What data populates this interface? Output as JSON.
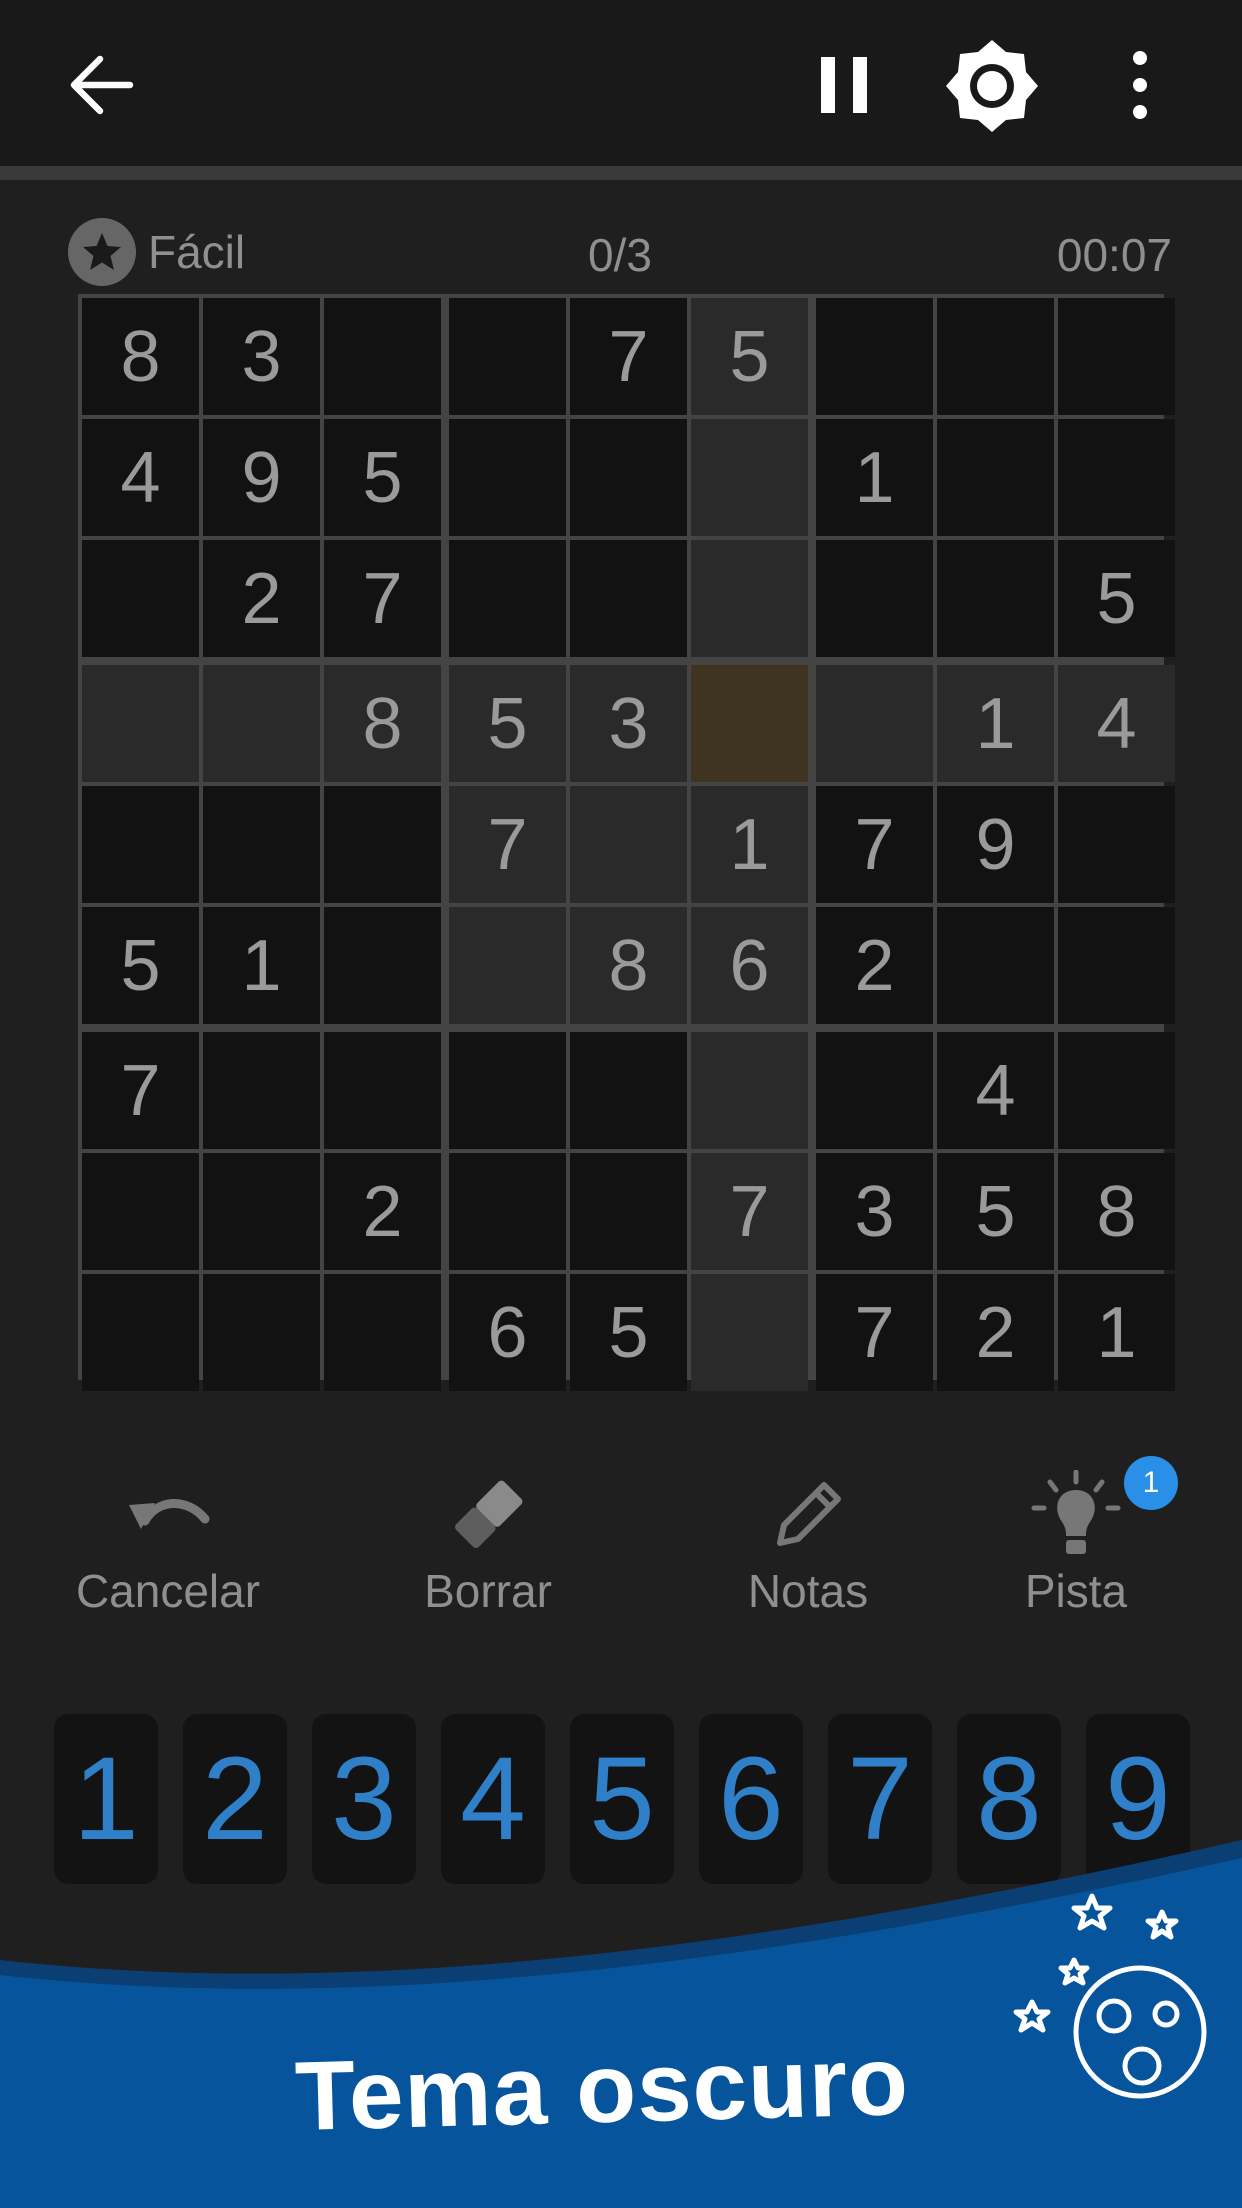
{
  "toolbar": {
    "back_icon": "arrow-left-icon",
    "pause_icon": "pause-icon",
    "brightness_icon": "brightness-icon",
    "more_icon": "more-vertical-icon"
  },
  "status": {
    "difficulty": "Fácil",
    "difficulty_icon": "star-icon",
    "mistakes": "0/3",
    "timer": "00:07"
  },
  "board": {
    "grid": [
      [
        "8",
        "3",
        "",
        "",
        "7",
        "5",
        "",
        "",
        ""
      ],
      [
        "4",
        "9",
        "5",
        "",
        "",
        "",
        "1",
        "",
        ""
      ],
      [
        "",
        "2",
        "7",
        "",
        "",
        "",
        "",
        "",
        "5"
      ],
      [
        "",
        "",
        "8",
        "5",
        "3",
        "",
        "",
        "1",
        "4"
      ],
      [
        "",
        "",
        "",
        "7",
        "",
        "1",
        "7",
        "9",
        ""
      ],
      [
        "5",
        "1",
        "",
        "",
        "8",
        "6",
        "2",
        "",
        ""
      ],
      [
        "7",
        "",
        "",
        "",
        "",
        "",
        "",
        "4",
        ""
      ],
      [
        "",
        "",
        "2",
        "",
        "",
        "7",
        "3",
        "5",
        "8"
      ],
      [
        "",
        "",
        "",
        "6",
        "5",
        "",
        "7",
        "2",
        "1"
      ]
    ],
    "selected_row": 3,
    "selected_col": 5
  },
  "tools": {
    "undo": {
      "label": "Cancelar",
      "icon": "undo-icon"
    },
    "erase": {
      "label": "Borrar",
      "icon": "eraser-icon"
    },
    "notes": {
      "label": "Notas",
      "icon": "pencil-icon"
    },
    "hint": {
      "label": "Pista",
      "icon": "lightbulb-icon",
      "badge": "1"
    }
  },
  "numpad": [
    "1",
    "2",
    "3",
    "4",
    "5",
    "6",
    "7",
    "8",
    "9"
  ],
  "banner": {
    "title": "Tema oscuro",
    "art_icon": "moon-stars-icon"
  },
  "colors": {
    "background": "#1f1f1f",
    "topbar": "#191919",
    "cell": "#121212",
    "highlight": "#2a2a2a",
    "selected": "#3f3420",
    "numpad_digit": "#2f80c8",
    "badge": "#2a8fe6",
    "banner": "#06559c"
  }
}
